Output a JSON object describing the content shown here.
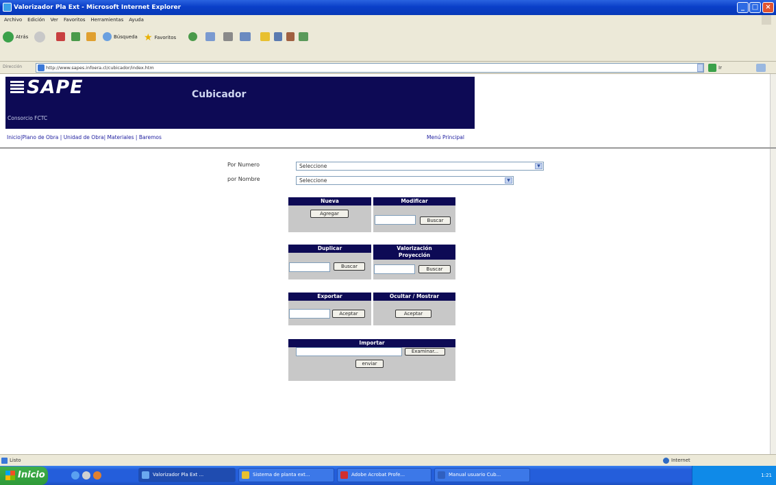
{
  "window": {
    "title": "Valorizador Pla Ext - Microsoft Internet Explorer"
  },
  "menubar": [
    "Archivo",
    "Edición",
    "Ver",
    "Favoritos",
    "Herramientas",
    "Ayuda"
  ],
  "toolbar": {
    "back_label": "Atrás",
    "search_label": "Búsqueda",
    "favorites_label": "Favoritos"
  },
  "address": {
    "label": "Dirección",
    "url": "http://www.sapes.infoera.cl/cubicador/index.htm",
    "go_label": "Ir"
  },
  "page": {
    "logo": "SAPE",
    "app_title": "Cubicador",
    "org": "Consorcio FCTC",
    "nav": "Inicio|Plano de Obra | Unidad de Obra| Materiales | Baremos",
    "menu_principal": "Menú Principal",
    "por_numero_label": "Por Numero",
    "por_nombre_label": "por Nombre",
    "select_numero": "Seleccione",
    "select_nombre": "Seleccione",
    "boxes": {
      "nueva": {
        "title": "Nueva",
        "button": "Agregar"
      },
      "modificar": {
        "title": "Modificar",
        "button": "Buscar"
      },
      "duplicar": {
        "title": "Duplicar",
        "button": "Buscar"
      },
      "valorizacion": {
        "title_line1": "Valorización",
        "title_line2": "Proyección",
        "button": "Buscar"
      },
      "exportar": {
        "title": "Exportar",
        "button": "Aceptar"
      },
      "ocultar": {
        "title": "Ocultar / Mostrar",
        "button": "Aceptar"
      },
      "importar": {
        "title": "Importar",
        "browse_button": "Examinar...",
        "send_button": "enviar"
      }
    }
  },
  "status": {
    "left": "Listo",
    "zone": "Internet"
  },
  "taskbar": {
    "start": "Inicio",
    "tasks": [
      "Valorizador Pla Ext ...",
      "Sistema de planta ext...",
      "Adobe Acrobat Profe...",
      "Manual usuario Cub..."
    ],
    "clock": "1:21"
  }
}
